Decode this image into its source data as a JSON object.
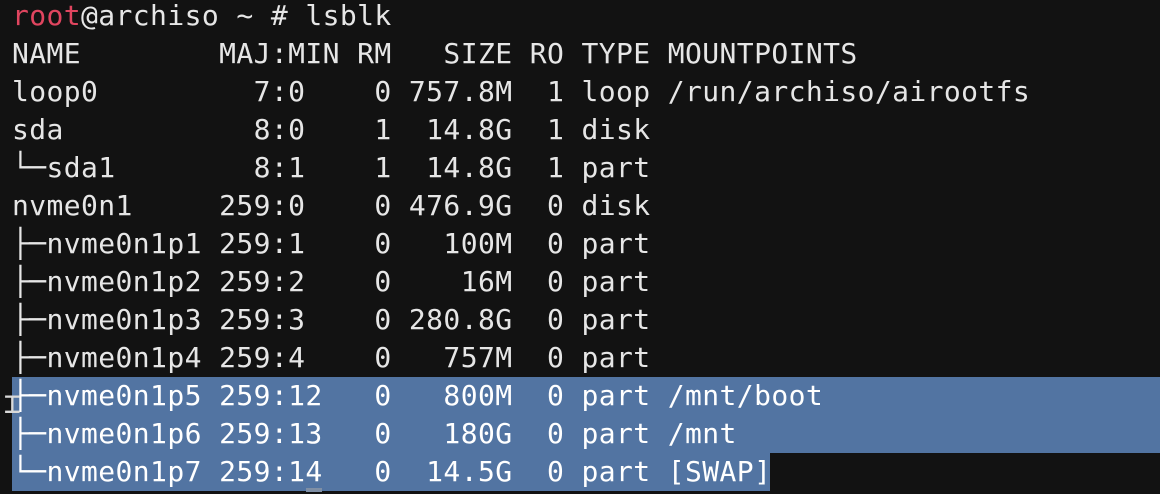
{
  "prompt": {
    "user": "root",
    "rest": "@archiso ~ # lsblk"
  },
  "lsblk": {
    "header": "NAME        MAJ:MIN RM   SIZE RO TYPE MOUNTPOINTS",
    "rows": [
      "loop0         7:0    0 757.8M  1 loop /run/archiso/airootfs",
      "sda           8:0    1  14.8G  1 disk",
      "└─sda1        8:1    1  14.8G  1 part",
      "nvme0n1     259:0    0 476.9G  0 disk",
      "├─nvme0n1p1 259:1    0   100M  0 part",
      "├─nvme0n1p2 259:2    0    16M  0 part",
      "├─nvme0n1p3 259:3    0 280.8G  0 part",
      "├─nvme0n1p4 259:4    0   757M  0 part",
      "├─nvme0n1p5 259:12   0   800M  0 part /mnt/boot",
      "├─nvme0n1p6 259:13   0   180G  0 part /mnt",
      "└─nvme0n1p7 259:14   0  14.5G  0 part [SWAP]"
    ]
  },
  "colors": {
    "background": "#121212",
    "text": "#e6e6e6",
    "prompt_user": "#e0455f",
    "selection": "#5274a2"
  },
  "cursor_icon": "text-ibeam-cursor-icon"
}
